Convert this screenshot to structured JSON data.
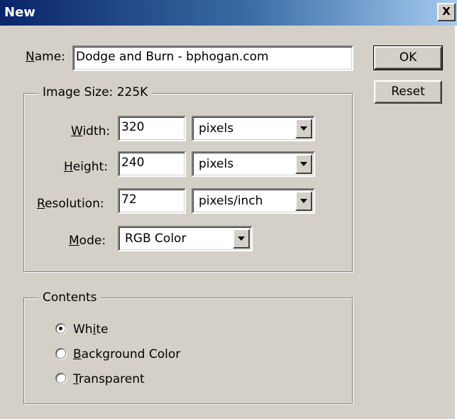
{
  "window": {
    "title": "New",
    "close_label": "X"
  },
  "name_field": {
    "label_prefix": "",
    "label_accel": "N",
    "label_rest": "ame:",
    "value": "Dodge and Burn - bphogan.com"
  },
  "buttons": {
    "ok": "OK",
    "reset": "Reset"
  },
  "image_size": {
    "legend": "Image Size:",
    "size": "225K",
    "width": {
      "label_accel": "W",
      "label_rest": "idth:",
      "value": "320",
      "unit": "pixels"
    },
    "height": {
      "label_accel": "H",
      "label_rest": "eight:",
      "value": "240",
      "unit": "pixels"
    },
    "resolution": {
      "label_accel": "R",
      "label_rest": "esolution:",
      "value": "72",
      "unit": "pixels/inch"
    },
    "mode": {
      "label_accel": "M",
      "label_rest": "ode:",
      "value": "RGB Color"
    }
  },
  "contents": {
    "legend": "Contents",
    "options": [
      {
        "pre": "Wh",
        "accel": "i",
        "post": "te",
        "checked": true
      },
      {
        "pre": "",
        "accel": "B",
        "post": "ackground Color",
        "checked": false
      },
      {
        "pre": "",
        "accel": "T",
        "post": "ransparent",
        "checked": false
      }
    ]
  }
}
